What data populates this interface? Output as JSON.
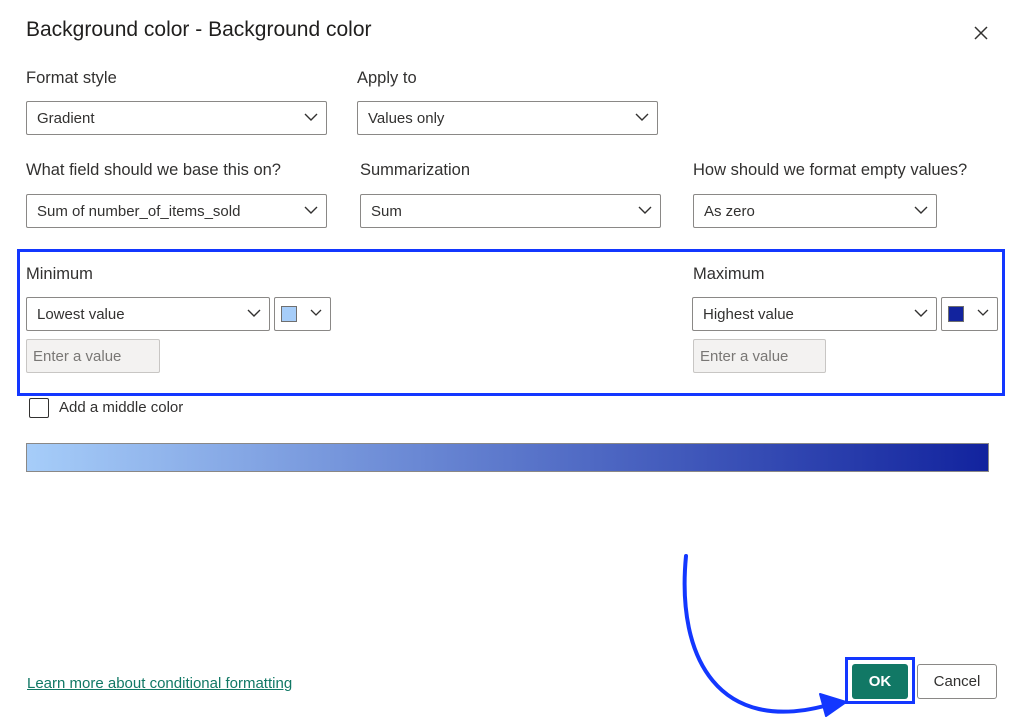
{
  "dialog": {
    "title": "Background color - Background color"
  },
  "format_style": {
    "label": "Format style",
    "value": "Gradient"
  },
  "apply_to": {
    "label": "Apply to",
    "value": "Values only"
  },
  "base_field": {
    "label": "What field should we base this on?",
    "value": "Sum of number_of_items_sold"
  },
  "summarization": {
    "label": "Summarization",
    "value": "Sum"
  },
  "empty_values": {
    "label": "How should we format empty values?",
    "value": "As zero"
  },
  "minimum": {
    "label": "Minimum",
    "type_value": "Lowest value",
    "color": "#a6cdf9",
    "input_placeholder": "Enter a value"
  },
  "maximum": {
    "label": "Maximum",
    "type_value": "Highest value",
    "color": "#12239e",
    "input_placeholder": "Enter a value"
  },
  "middle_color": {
    "label": "Add a middle color",
    "checked": false
  },
  "gradient": {
    "start": "#a6cdf9",
    "end": "#12239e"
  },
  "footer": {
    "link": "Learn more about conditional formatting",
    "ok_label": "OK",
    "cancel_label": "Cancel"
  },
  "colors": {
    "accent": "#117865",
    "highlight": "#1337ff"
  }
}
